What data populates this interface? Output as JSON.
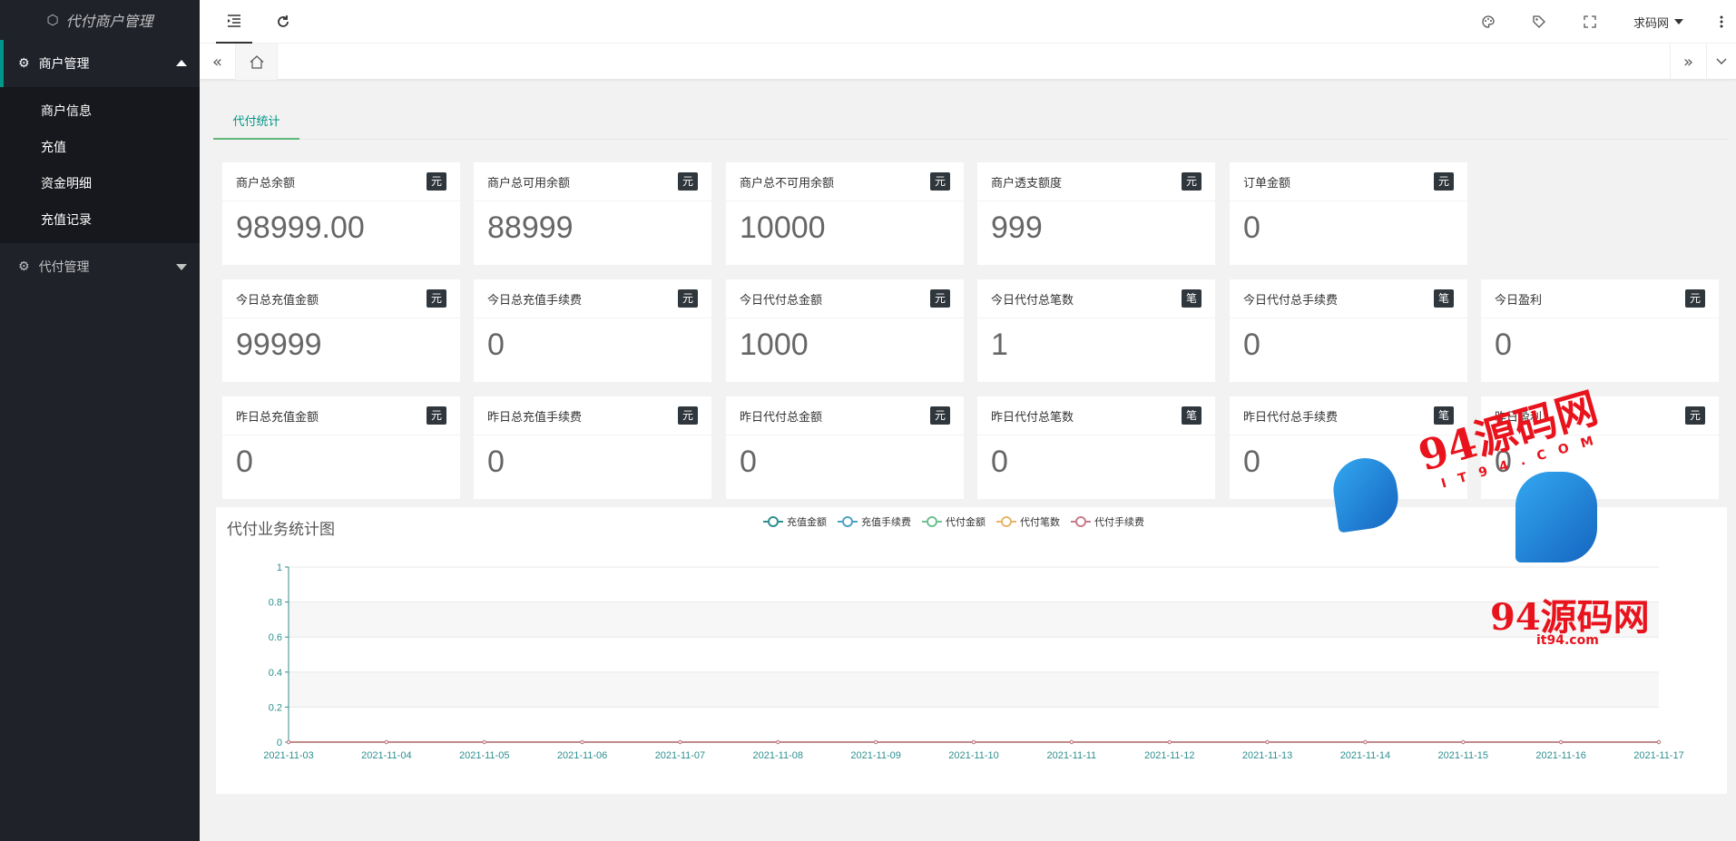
{
  "sidebar": {
    "title": "代付商户管理",
    "groups": [
      {
        "label": "商户管理",
        "items": [
          "商户信息",
          "充值",
          "资金明细",
          "充值记录"
        ]
      },
      {
        "label": "代付管理"
      }
    ]
  },
  "header": {
    "user": "求码网"
  },
  "content_tab": "代付统计",
  "cards_row1": [
    {
      "label": "商户总余额",
      "badge": "元",
      "value": "98999.00"
    },
    {
      "label": "商户总可用余额",
      "badge": "元",
      "value": "88999"
    },
    {
      "label": "商户总不可用余额",
      "badge": "元",
      "value": "10000"
    },
    {
      "label": "商户透支额度",
      "badge": "元",
      "value": "999"
    },
    {
      "label": "订单金额",
      "badge": "元",
      "value": "0"
    }
  ],
  "cards_row2": [
    {
      "label": "今日总充值金额",
      "badge": "元",
      "value": "99999"
    },
    {
      "label": "今日总充值手续费",
      "badge": "元",
      "value": "0"
    },
    {
      "label": "今日代付总金额",
      "badge": "元",
      "value": "1000"
    },
    {
      "label": "今日代付总笔数",
      "badge": "笔",
      "value": "1"
    },
    {
      "label": "今日代付总手续费",
      "badge": "笔",
      "value": "0"
    },
    {
      "label": "今日盈利",
      "badge": "元",
      "value": "0"
    }
  ],
  "cards_row3": [
    {
      "label": "昨日总充值金额",
      "badge": "元",
      "value": "0"
    },
    {
      "label": "昨日总充值手续费",
      "badge": "元",
      "value": "0"
    },
    {
      "label": "昨日代付总金额",
      "badge": "元",
      "value": "0"
    },
    {
      "label": "昨日代付总笔数",
      "badge": "笔",
      "value": "0"
    },
    {
      "label": "昨日代付总手续费",
      "badge": "笔",
      "value": "0"
    },
    {
      "label": "昨日盈利",
      "badge": "元",
      "value": "0"
    }
  ],
  "watermark": {
    "text1": "94源码网",
    "text2": "IT94.COM",
    "text3": "94源码网",
    "text4": "it94.com"
  },
  "chart_data": {
    "type": "line",
    "title": "代付业务统计图",
    "categories": [
      "2021-11-03",
      "2021-11-04",
      "2021-11-05",
      "2021-11-06",
      "2021-11-07",
      "2021-11-08",
      "2021-11-09",
      "2021-11-10",
      "2021-11-11",
      "2021-11-12",
      "2021-11-13",
      "2021-11-14",
      "2021-11-15",
      "2021-11-16",
      "2021-11-17"
    ],
    "series": [
      {
        "name": "充值金额",
        "color": "#2f8f8f",
        "values": [
          0,
          0,
          0,
          0,
          0,
          0,
          0,
          0,
          0,
          0,
          0,
          0,
          0,
          0,
          0
        ]
      },
      {
        "name": "充值手续费",
        "color": "#4aa3c8",
        "values": [
          0,
          0,
          0,
          0,
          0,
          0,
          0,
          0,
          0,
          0,
          0,
          0,
          0,
          0,
          0
        ]
      },
      {
        "name": "代付金额",
        "color": "#6fbf8f",
        "values": [
          0,
          0,
          0,
          0,
          0,
          0,
          0,
          0,
          0,
          0,
          0,
          0,
          0,
          0,
          0
        ]
      },
      {
        "name": "代付笔数",
        "color": "#e8b46a",
        "values": [
          0,
          0,
          0,
          0,
          0,
          0,
          0,
          0,
          0,
          0,
          0,
          0,
          0,
          0,
          0
        ]
      },
      {
        "name": "代付手续费",
        "color": "#c77b8a",
        "values": [
          0,
          0,
          0,
          0,
          0,
          0,
          0,
          0,
          0,
          0,
          0,
          0,
          0,
          0,
          0
        ]
      }
    ],
    "y_ticks": [
      "0",
      "0.2",
      "0.4",
      "0.6",
      "0.8",
      "1"
    ],
    "ylim": [
      0,
      1
    ],
    "grid": true,
    "legend": "top-center"
  }
}
